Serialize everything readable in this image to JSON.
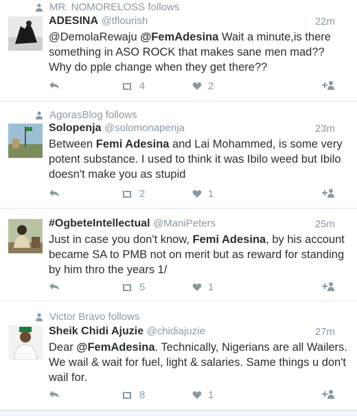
{
  "tweets": [
    {
      "context": "MR. NOMORELOSS follows",
      "name": "ADESINA",
      "handle": "@tflourish",
      "time": "22m",
      "text_parts": [
        "@DemolaRewaju ",
        "@FemAdesina",
        " Wait a minute,is there something in ASO ROCK that makes sane men mad?? Why do pple change when they get there??"
      ],
      "retweets": "4",
      "likes": "2"
    },
    {
      "context": "AgorasBlog follows",
      "name": "Solopenja",
      "handle": "@solomonapenja",
      "time": "23m",
      "text_parts": [
        "Between ",
        "Femi Adesina",
        " and Lai Mohammed, is some very potent substance. I used to think it was Ibilo weed but Ibilo doesn't make you as stupid"
      ],
      "retweets": "2",
      "likes": "1"
    },
    {
      "context": "",
      "name": "#OgbeteIntellectual",
      "handle": "@ManiPeters",
      "time": "25m",
      "text_parts": [
        "Just in case you don't know, ",
        "Femi Adesina",
        ", by his account became SA to PMB not on merit but as reward for standing by him thro the years 1/"
      ],
      "retweets": "5",
      "likes": "1"
    },
    {
      "context": "Victor Bravo follows",
      "name": "Sheik Chidi Ajuzie",
      "handle": "@chidiajuzie",
      "time": "27m",
      "text_parts": [
        "Dear ",
        "@FemAdesina",
        ". Technically, Nigerians are all Wailers. We wail & wait for fuel, light & salaries. Same things u don't wail for."
      ],
      "retweets": "8",
      "likes": "1"
    }
  ],
  "icons": {
    "reply": "reply-icon",
    "retweet": "retweet-icon",
    "like": "heart-icon",
    "follow": "follow-icon",
    "context": "person-icon"
  },
  "colors": {
    "text": "#292f33",
    "muted": "#8899a6",
    "divider": "#e1e8ed"
  }
}
